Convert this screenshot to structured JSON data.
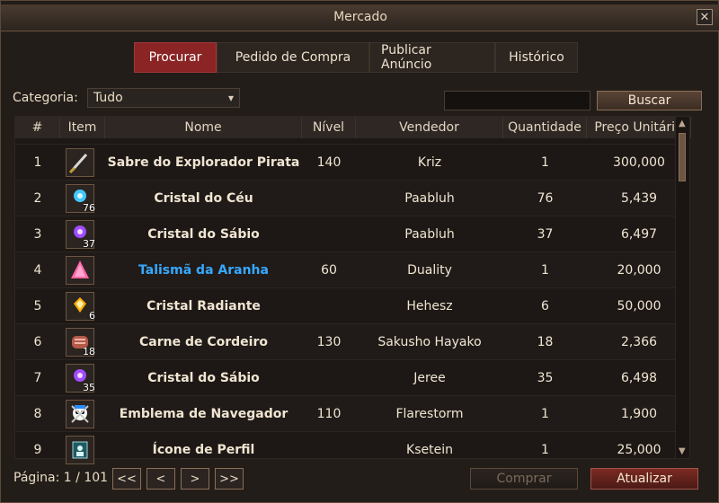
{
  "window": {
    "title": "Mercado",
    "close_symbol": "✕"
  },
  "tabs": [
    {
      "label": "Procurar",
      "active": true
    },
    {
      "label": "Pedido de Compra",
      "active": false
    },
    {
      "label": "Publicar Anúncio",
      "active": false
    },
    {
      "label": "Histórico",
      "active": false
    }
  ],
  "filter": {
    "category_label": "Categoria:",
    "category_value": "Tudo",
    "search_value": "",
    "search_button": "Buscar"
  },
  "table": {
    "headers": [
      "#",
      "Item",
      "Nome",
      "Nível",
      "Vendedor",
      "Quantidade",
      "Preço Unitário"
    ],
    "rows": [
      {
        "n": "1",
        "name": "Sabre do Explorador Pirata",
        "level": "140",
        "seller": "Kriz",
        "qty": "1",
        "price": "300,000",
        "icon": "saber-icon",
        "icon_qty": "",
        "highlight": false
      },
      {
        "n": "2",
        "name": "Cristal do Céu",
        "level": "",
        "seller": "Paabluh",
        "qty": "76",
        "price": "5,439",
        "icon": "sky-crystal-icon",
        "icon_qty": "76",
        "highlight": false
      },
      {
        "n": "3",
        "name": "Cristal do Sábio",
        "level": "",
        "seller": "Paabluh",
        "qty": "37",
        "price": "6,497",
        "icon": "sage-crystal-icon",
        "icon_qty": "37",
        "highlight": false
      },
      {
        "n": "4",
        "name": "Talismã da Aranha",
        "level": "60",
        "seller": "Duality",
        "qty": "1",
        "price": "20,000",
        "icon": "spider-talisman-icon",
        "icon_qty": "",
        "highlight": true
      },
      {
        "n": "5",
        "name": "Cristal Radiante",
        "level": "",
        "seller": "Hehesz",
        "qty": "6",
        "price": "50,000",
        "icon": "radiant-crystal-icon",
        "icon_qty": "6",
        "highlight": false
      },
      {
        "n": "6",
        "name": "Carne de Cordeiro",
        "level": "130",
        "seller": "Sakusho Hayako",
        "qty": "18",
        "price": "2,366",
        "icon": "lamb-meat-icon",
        "icon_qty": "18",
        "highlight": false
      },
      {
        "n": "7",
        "name": "Cristal do Sábio",
        "level": "",
        "seller": "Jeree",
        "qty": "35",
        "price": "6,498",
        "icon": "sage-crystal-icon",
        "icon_qty": "35",
        "highlight": false
      },
      {
        "n": "8",
        "name": "Emblema de Navegador",
        "level": "110",
        "seller": "Flarestorm",
        "qty": "1",
        "price": "1,900",
        "icon": "navigator-emblem-icon",
        "icon_qty": "",
        "highlight": false
      },
      {
        "n": "9",
        "name": "Ícone de Perfil",
        "level": "",
        "seller": "Ksetein",
        "qty": "1",
        "price": "25,000",
        "icon": "profile-icon",
        "icon_qty": "",
        "highlight": false
      }
    ]
  },
  "footer": {
    "page_label": "Página: 1 / 101",
    "pager_buttons": [
      "<<",
      "<",
      ">",
      ">>"
    ],
    "buy_button": "Comprar",
    "refresh_button": "Atualizar"
  }
}
